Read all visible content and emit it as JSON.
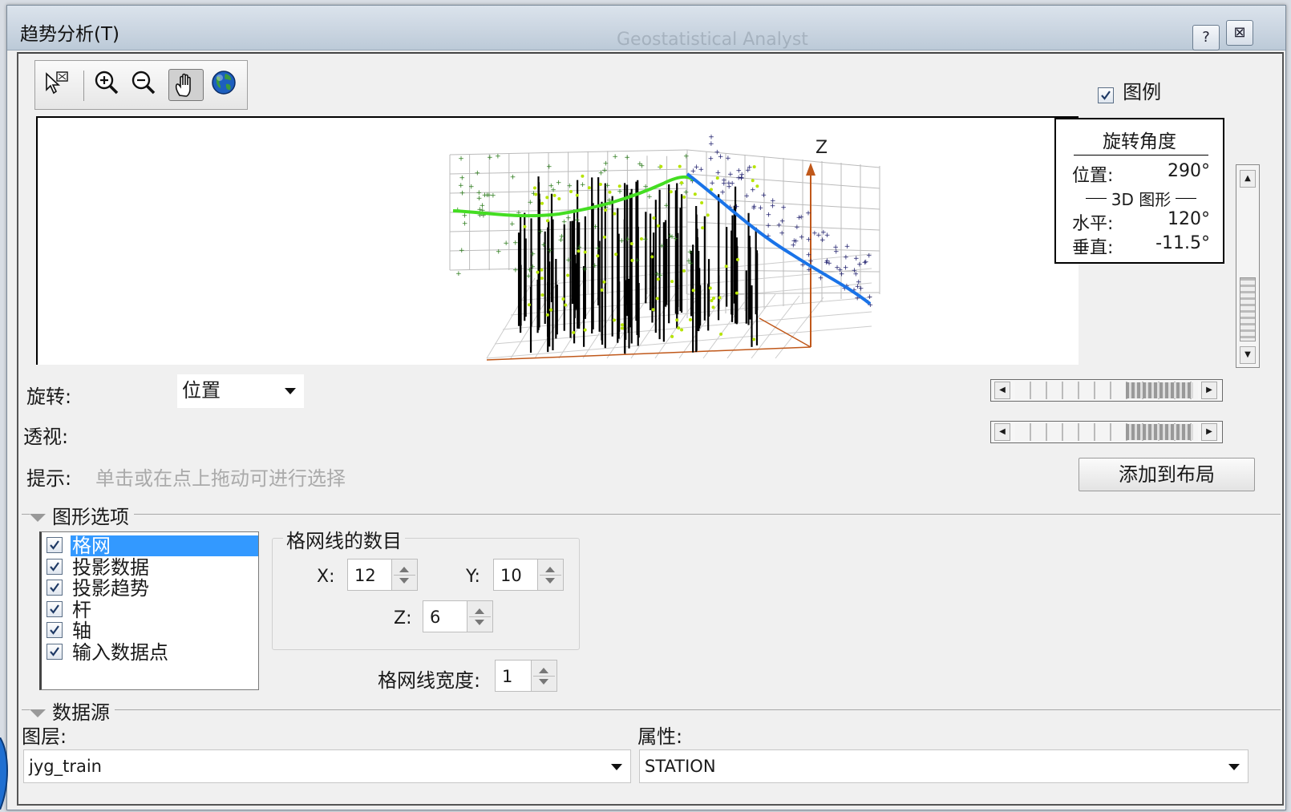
{
  "window": {
    "title": "趋势分析(T)",
    "background_ghost_text": "Geostatistical Analyst",
    "help_button": "?",
    "close_button": "⊠"
  },
  "toolbar": {
    "tools": [
      {
        "name": "select-icon"
      },
      {
        "name": "zoom-in-icon"
      },
      {
        "name": "zoom-out-icon"
      },
      {
        "name": "pan-icon",
        "pressed": true
      },
      {
        "name": "globe-icon"
      }
    ]
  },
  "legend": {
    "checked": true,
    "label": "图例"
  },
  "plot": {
    "axis_label": "Z",
    "trend_colors": {
      "green": "#44dd22",
      "blue": "#1a73e8",
      "axis": "#c0581a"
    }
  },
  "rotation_panel": {
    "title": "旋转角度",
    "position_label": "位置:",
    "position_value": "290°",
    "section_label": "3D 图形",
    "horizontal_label": "水平:",
    "horizontal_value": "120°",
    "vertical_label": "垂直:",
    "vertical_value": "-11.5°"
  },
  "controls": {
    "rotate_label": "旋转:",
    "rotate_value": "位置",
    "perspective_label": "透视:",
    "hint_label": "提示:",
    "hint_text": "单击或在点上拖动可进行选择",
    "add_to_layout": "添加到布局"
  },
  "graph_options": {
    "header": "图形选项",
    "items": [
      {
        "label": "格网",
        "checked": true,
        "selected": true
      },
      {
        "label": "投影数据",
        "checked": true,
        "selected": false
      },
      {
        "label": "投影趋势",
        "checked": true,
        "selected": false
      },
      {
        "label": "杆",
        "checked": true,
        "selected": false
      },
      {
        "label": "轴",
        "checked": true,
        "selected": false
      },
      {
        "label": "输入数据点",
        "checked": true,
        "selected": false
      }
    ],
    "grid_group_title": "格网线的数目",
    "x_label": "X:",
    "x_value": "12",
    "y_label": "Y:",
    "y_value": "10",
    "z_label": "Z:",
    "z_value": "6",
    "width_label": "格网线宽度:",
    "width_value": "1"
  },
  "data_source": {
    "header": "数据源",
    "layer_label": "图层:",
    "layer_value": "jyg_train",
    "attribute_label": "属性:",
    "attribute_value": "STATION"
  }
}
